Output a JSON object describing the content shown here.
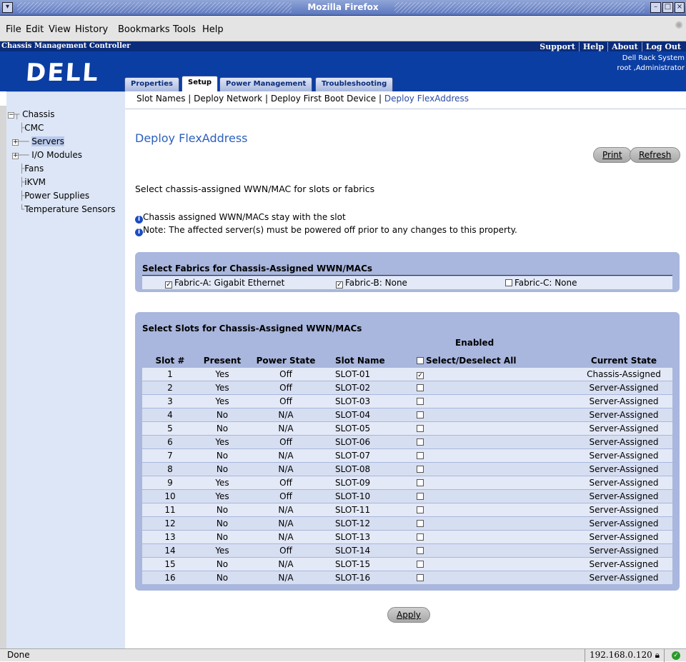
{
  "window": {
    "title": "Mozilla Firefox"
  },
  "menu": [
    "File",
    "Edit",
    "View",
    "History",
    "Bookmarks",
    "Tools",
    "Help"
  ],
  "header": {
    "app_title": "Chassis Management Controller",
    "links": [
      "Support",
      "Help",
      "About",
      "Log Out"
    ],
    "system_name": "Dell Rack System",
    "user": "root ,Administrator",
    "logo": "DELL",
    "tabs": [
      "Properties",
      "Setup",
      "Power Management",
      "Troubleshooting"
    ],
    "active_tab": "Setup"
  },
  "subnav": {
    "items": [
      "Slot Names",
      "Deploy Network",
      "Deploy First Boot Device",
      "Deploy FlexAddress"
    ],
    "separator": "|",
    "current": "Deploy FlexAddress"
  },
  "sidebar": {
    "tree": [
      {
        "label": "Chassis",
        "expander": "−"
      },
      {
        "label": "CMC"
      },
      {
        "label": "Servers",
        "expander": "+",
        "selected": true
      },
      {
        "label": "I/O Modules",
        "expander": "+"
      },
      {
        "label": "Fans"
      },
      {
        "label": "iKVM"
      },
      {
        "label": "Power Supplies"
      },
      {
        "label": "Temperature Sensors"
      }
    ]
  },
  "page": {
    "title": "Deploy FlexAddress",
    "print_label": "Print",
    "refresh_label": "Refresh",
    "instruction": "Select chassis-assigned WWN/MAC for slots or fabrics",
    "info_icon_glyph": "i",
    "note1": "Chassis assigned WWN/MACs stay with the slot",
    "note2": "Note: The affected server(s) must be powered off prior to any changes to this property.",
    "apply_label": "Apply"
  },
  "fabrics": {
    "title": "Select Fabrics for Chassis-Assigned WWN/MACs",
    "items": [
      {
        "label": "Fabric-A: Gigabit Ethernet",
        "checked": true
      },
      {
        "label": "Fabric-B: None",
        "checked": true
      },
      {
        "label": "Fabric-C: None",
        "checked": false
      }
    ]
  },
  "slots": {
    "title": "Select Slots for Chassis-Assigned WWN/MACs",
    "enabled_header": "Enabled",
    "columns": [
      "Slot #",
      "Present",
      "Power State",
      "Slot Name",
      "Select/Deselect All",
      "Current State"
    ],
    "select_all_checked": false,
    "rows": [
      {
        "slot": "1",
        "present": "Yes",
        "power": "Off",
        "name": "SLOT-01",
        "enabled": true,
        "state": "Chassis-Assigned"
      },
      {
        "slot": "2",
        "present": "Yes",
        "power": "Off",
        "name": "SLOT-02",
        "enabled": false,
        "state": "Server-Assigned"
      },
      {
        "slot": "3",
        "present": "Yes",
        "power": "Off",
        "name": "SLOT-03",
        "enabled": false,
        "state": "Server-Assigned"
      },
      {
        "slot": "4",
        "present": "No",
        "power": "N/A",
        "name": "SLOT-04",
        "enabled": false,
        "state": "Server-Assigned"
      },
      {
        "slot": "5",
        "present": "No",
        "power": "N/A",
        "name": "SLOT-05",
        "enabled": false,
        "state": "Server-Assigned"
      },
      {
        "slot": "6",
        "present": "Yes",
        "power": "Off",
        "name": "SLOT-06",
        "enabled": false,
        "state": "Server-Assigned"
      },
      {
        "slot": "7",
        "present": "No",
        "power": "N/A",
        "name": "SLOT-07",
        "enabled": false,
        "state": "Server-Assigned"
      },
      {
        "slot": "8",
        "present": "No",
        "power": "N/A",
        "name": "SLOT-08",
        "enabled": false,
        "state": "Server-Assigned"
      },
      {
        "slot": "9",
        "present": "Yes",
        "power": "Off",
        "name": "SLOT-09",
        "enabled": false,
        "state": "Server-Assigned"
      },
      {
        "slot": "10",
        "present": "Yes",
        "power": "Off",
        "name": "SLOT-10",
        "enabled": false,
        "state": "Server-Assigned"
      },
      {
        "slot": "11",
        "present": "No",
        "power": "N/A",
        "name": "SLOT-11",
        "enabled": false,
        "state": "Server-Assigned"
      },
      {
        "slot": "12",
        "present": "No",
        "power": "N/A",
        "name": "SLOT-12",
        "enabled": false,
        "state": "Server-Assigned"
      },
      {
        "slot": "13",
        "present": "No",
        "power": "N/A",
        "name": "SLOT-13",
        "enabled": false,
        "state": "Server-Assigned"
      },
      {
        "slot": "14",
        "present": "Yes",
        "power": "Off",
        "name": "SLOT-14",
        "enabled": false,
        "state": "Server-Assigned"
      },
      {
        "slot": "15",
        "present": "No",
        "power": "N/A",
        "name": "SLOT-15",
        "enabled": false,
        "state": "Server-Assigned"
      },
      {
        "slot": "16",
        "present": "No",
        "power": "N/A",
        "name": "SLOT-16",
        "enabled": false,
        "state": "Server-Assigned"
      }
    ]
  },
  "status": {
    "text": "Done",
    "host": "192.168.0.120"
  },
  "colors": {
    "header_blue": "#0b3ea3",
    "panel": "#a9b7de",
    "link_blue": "#2b5fbd",
    "sidebar": "#dde6f6"
  }
}
